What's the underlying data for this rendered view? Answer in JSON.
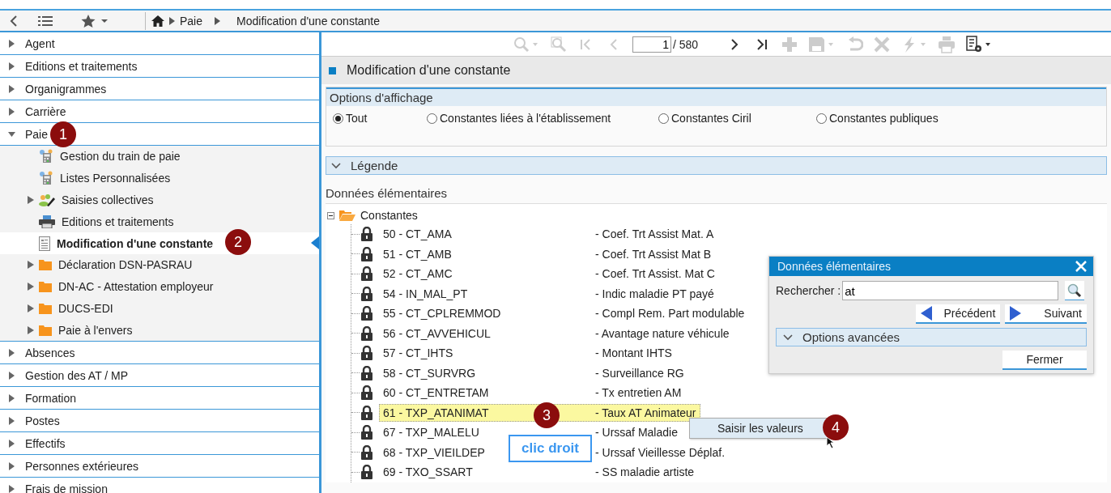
{
  "nav_bar": {
    "breadcrumb": [
      "Paie",
      "Modification d'une constante"
    ]
  },
  "sidebar": {
    "items": [
      {
        "label": "Agent",
        "expanded": false
      },
      {
        "label": "Editions et traitements",
        "expanded": false
      },
      {
        "label": "Organigrammes",
        "expanded": false
      },
      {
        "label": "Carrière",
        "expanded": false
      },
      {
        "label": "Paie",
        "expanded": true,
        "children": [
          {
            "label": "Gestion du train de paie",
            "kind": "calculator",
            "expandable": false,
            "selected": false
          },
          {
            "label": "Listes Personnalisées",
            "kind": "calculator",
            "expandable": false,
            "selected": false
          },
          {
            "label": "Saisies collectives",
            "kind": "people",
            "expandable": true,
            "selected": false
          },
          {
            "label": "Editions et traitements",
            "kind": "printer",
            "expandable": false,
            "selected": false
          },
          {
            "label": "Modification d'une constante",
            "kind": "document",
            "expandable": false,
            "selected": true
          },
          {
            "label": "Déclaration DSN-PASRAU",
            "kind": "folder",
            "expandable": true,
            "selected": false
          },
          {
            "label": "DN-AC - Attestation employeur",
            "kind": "folder",
            "expandable": true,
            "selected": false
          },
          {
            "label": "DUCS-EDI",
            "kind": "folder",
            "expandable": true,
            "selected": false
          },
          {
            "label": "Paie à l'envers",
            "kind": "folder",
            "expandable": true,
            "selected": false
          }
        ]
      },
      {
        "label": "Absences",
        "expanded": false
      },
      {
        "label": "Gestion des AT / MP",
        "expanded": false
      },
      {
        "label": "Formation",
        "expanded": false
      },
      {
        "label": "Postes",
        "expanded": false
      },
      {
        "label": "Effectifs",
        "expanded": false
      },
      {
        "label": "Personnes extérieures",
        "expanded": false
      },
      {
        "label": "Frais de mission",
        "expanded": false
      }
    ]
  },
  "toolbar": {
    "pager": {
      "page": "1",
      "total": "/ 580"
    },
    "tools": [
      {
        "kind": "search",
        "disabled": true
      },
      {
        "kind": "zoom",
        "disabled": true
      },
      {
        "kind": "first",
        "disabled": true
      },
      {
        "kind": "previous",
        "disabled": true
      },
      {
        "kind": "pager"
      },
      {
        "kind": "next",
        "disabled": false
      },
      {
        "kind": "last",
        "disabled": false
      },
      {
        "kind": "add",
        "disabled": true
      },
      {
        "kind": "save",
        "disabled": true
      },
      {
        "kind": "undo",
        "disabled": true
      },
      {
        "kind": "delete",
        "disabled": true
      },
      {
        "kind": "action",
        "disabled": true
      },
      {
        "kind": "print",
        "disabled": true
      },
      {
        "kind": "settings",
        "disabled": false
      }
    ]
  },
  "panel": {
    "title": "Modification d'une constante",
    "display_options": {
      "title": "Options d'affichage",
      "radios": [
        {
          "label": "Tout",
          "selected": true
        },
        {
          "label": "Constantes liées à l'établissement",
          "selected": false
        },
        {
          "label": "Constantes Ciril",
          "selected": false
        },
        {
          "label": "Constantes publiques",
          "selected": false
        }
      ]
    },
    "legend": {
      "title": "Légende",
      "expanded": false
    },
    "section_label": "Données élémentaires",
    "tree": {
      "label": "Constantes",
      "expanded": true,
      "children": [
        {
          "code": "50 - CT_AMA",
          "description": "- Coef. Trt Assist Mat. A",
          "selected": false
        },
        {
          "code": "51 - CT_AMB",
          "description": "- Coef. Trt Assist Mat B",
          "selected": false
        },
        {
          "code": "52 - CT_AMC",
          "description": "- Coef. Trt Assist. Mat C",
          "selected": false
        },
        {
          "code": "54 - IN_MAL_PT",
          "description": "- Indic maladie PT payé",
          "selected": false
        },
        {
          "code": "55 - CT_CPLREMMOD",
          "description": "- Compl Rem. Part modulable",
          "selected": false
        },
        {
          "code": "56 - CT_AVVEHICUL",
          "description": "- Avantage nature véhicule",
          "selected": false
        },
        {
          "code": "57 - CT_IHTS",
          "description": "- Montant IHTS",
          "selected": false
        },
        {
          "code": "58 - CT_SURVRG",
          "description": "- Surveillance RG",
          "selected": false
        },
        {
          "code": "60 - CT_ENTRETAM",
          "description": "- Tx entretien AM",
          "selected": false
        },
        {
          "code": "61 - TXP_ATANIMAT",
          "description": "- Taux AT Animateur",
          "selected": true
        },
        {
          "code": "67 - TXP_MALELU",
          "description": "- Urssaf Maladie",
          "selected": false
        },
        {
          "code": "68 - TXP_VIEILDEP",
          "description": "- Urssaf Vieillesse Déplaf.",
          "selected": false
        },
        {
          "code": "69 - TXO_SSART",
          "description": "- SS maladie artiste",
          "selected": false
        }
      ]
    }
  },
  "search_dialog": {
    "title": "Données élémentaires",
    "search_label": "Rechercher :",
    "search_value": "at",
    "previous_button": "Précédent",
    "next_button": "Suivant",
    "advanced": {
      "title": "Options avancées",
      "expanded": false
    },
    "close_button": "Fermer"
  },
  "context_menu": {
    "items": [
      "Saisir les valeurs"
    ]
  },
  "annotations": {
    "steps": [
      "1",
      "2",
      "3",
      "4"
    ],
    "callout": "clic droit"
  }
}
